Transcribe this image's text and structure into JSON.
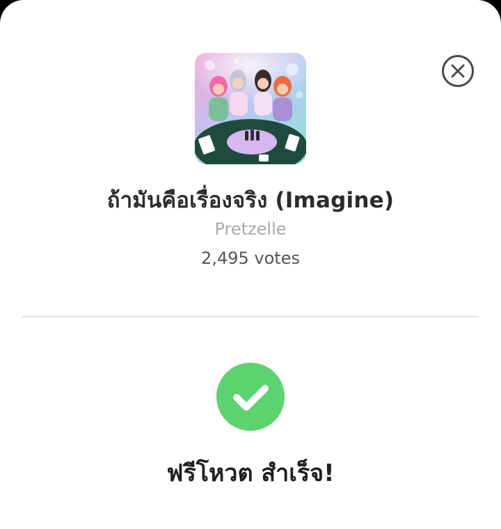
{
  "colors": {
    "sheet_background": "#ffffff",
    "success_green": "#5cd36f",
    "title_text": "#2b2b2b",
    "artist_text": "#a9a9a9",
    "votes_text": "#555555",
    "close_icon": "#4a4a4a"
  },
  "header": {
    "close_icon": "close-icon"
  },
  "song": {
    "title": "ถ้ามันคือเรื่องจริง (Imagine)",
    "artist": "Pretzelle",
    "votes": "2,495 votes"
  },
  "result": {
    "icon": "check-circle-icon",
    "message": "ฟรีโหวต สำเร็จ!"
  }
}
